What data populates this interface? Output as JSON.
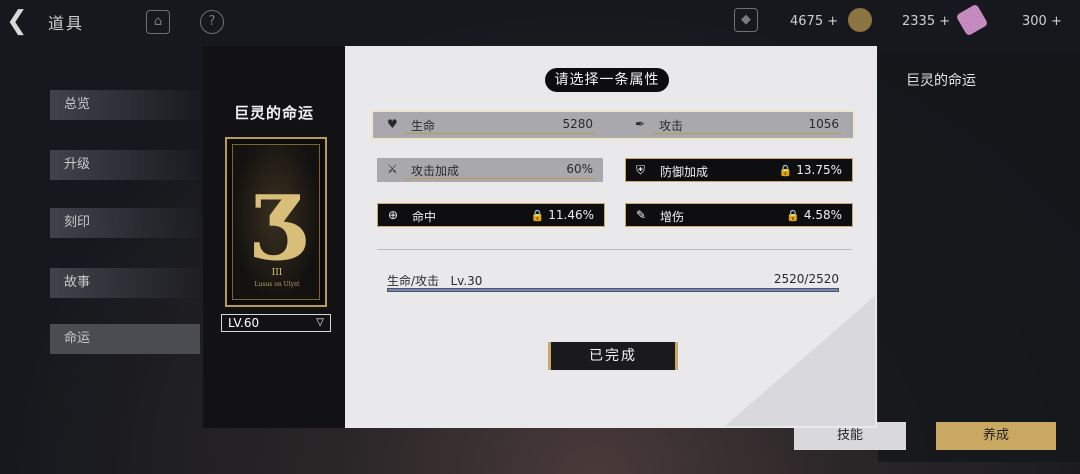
{
  "topbar": {
    "back_glyph": "❮",
    "title": "道具",
    "resources": [
      {
        "icon": "crystal-icon",
        "amount": "4675",
        "plus": "+",
        "color": "#8fa3d8"
      },
      {
        "icon": "coin-icon",
        "amount": "2335",
        "plus": "+",
        "color": "#c7a458"
      },
      {
        "icon": "ticket-icon",
        "amount": "300",
        "plus": "+",
        "color": "#e0a8d8"
      }
    ]
  },
  "sidebar": {
    "items": [
      {
        "label": "总览"
      },
      {
        "label": "升级"
      },
      {
        "label": "刻印"
      },
      {
        "label": "故事"
      },
      {
        "label": "命运"
      }
    ]
  },
  "card": {
    "title": "巨灵的命运",
    "numeral": "III",
    "subtitle": "Lusus on Ulyst",
    "level": "LV.60",
    "level_arrow": "▽"
  },
  "dialog": {
    "header": "请选择一条属性",
    "stats": [
      {
        "icon": "heart-icon",
        "glyph": "♥",
        "label": "生命",
        "value": "5280",
        "style": "grey",
        "locked": false
      },
      {
        "icon": "quill-icon",
        "glyph": "✒",
        "label": "攻击",
        "value": "1056",
        "style": "grey",
        "locked": false
      },
      {
        "icon": "attack-bonus-icon",
        "glyph": "⚔",
        "label": "攻击加成",
        "value": "60%",
        "style": "grey",
        "locked": false
      },
      {
        "icon": "shield-icon",
        "glyph": "⛨",
        "label": "防御加成",
        "value": "13.75%",
        "style": "dark",
        "locked": true
      },
      {
        "icon": "target-icon",
        "glyph": "⊕",
        "label": "命中",
        "value": "11.46%",
        "style": "dark",
        "locked": true
      },
      {
        "icon": "damage-up-icon",
        "glyph": "✎",
        "label": "增伤",
        "value": "4.58%",
        "style": "dark",
        "locked": true
      }
    ],
    "progress": {
      "label": "生命/攻击",
      "level": "Lv.30",
      "value": "2520/2520",
      "fraction": 1.0
    },
    "done_label": "已完成"
  },
  "right_panel": {
    "title": "巨灵的命运",
    "bottom_buttons": [
      {
        "label": "技能"
      },
      {
        "label": "养成"
      }
    ]
  },
  "colors": {
    "gold": "#caa866",
    "progress": "#6f86c9",
    "dialog_bg": "#e9e9ec"
  }
}
